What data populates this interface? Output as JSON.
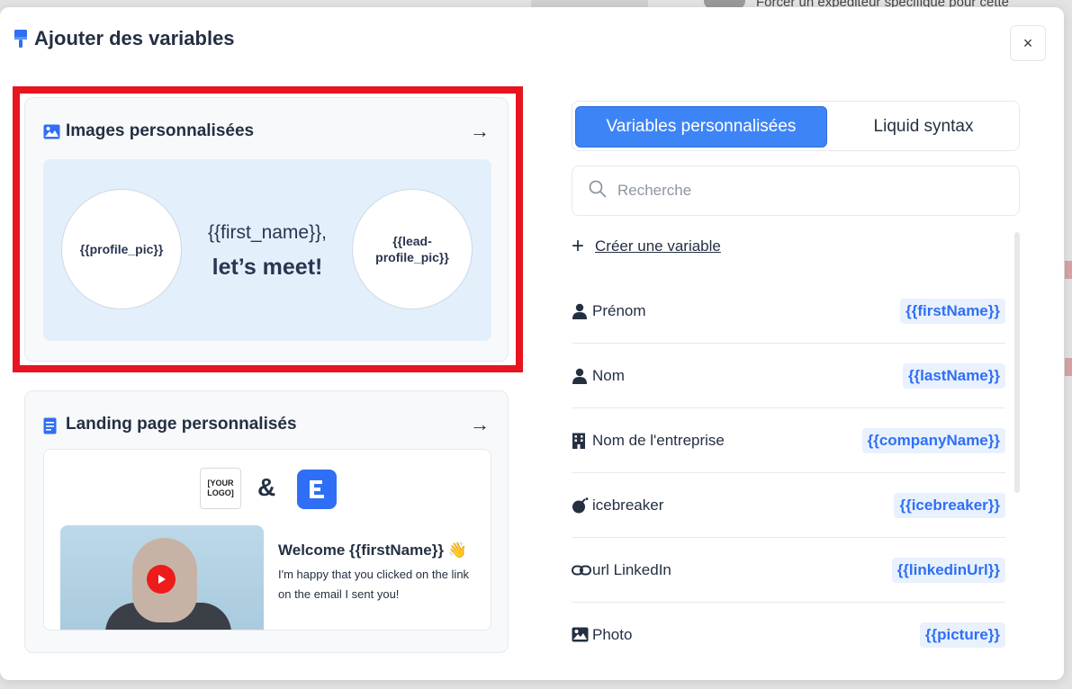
{
  "background": {
    "hint_text": "Forcer un expéditeur spécifique pour cette"
  },
  "modal": {
    "title": "Ajouter des variables",
    "close_label": "×"
  },
  "cards": {
    "images": {
      "label": "Images personnalisées",
      "arrow": "→",
      "preview": {
        "left_circle": "{{profile_pic}}",
        "greeting_line1": "{{first_name}},",
        "greeting_line2": "let’s meet!",
        "right_circle": "{{lead-profile_pic}}"
      }
    },
    "landing": {
      "label": "Landing page personnalisés",
      "arrow": "→",
      "preview": {
        "logo_text": "[YOUR LOGO]",
        "amp": "&",
        "welcome_title": "Welcome {{firstName}} 👋",
        "welcome_text": "I'm happy that you clicked on the link on the email I sent you!"
      }
    }
  },
  "tabs": [
    {
      "label": "Variables personnalisées",
      "active": true
    },
    {
      "label": "Liquid syntax",
      "active": false
    }
  ],
  "search": {
    "placeholder": "Recherche",
    "value": ""
  },
  "create_variable": {
    "label": "Créer une variable"
  },
  "variables": [
    {
      "icon": "person-icon",
      "label": "Prénom",
      "tag": "{{firstName}}"
    },
    {
      "icon": "person-icon",
      "label": "Nom",
      "tag": "{{lastName}}"
    },
    {
      "icon": "building-icon",
      "label": "Nom de l'entreprise",
      "tag": "{{companyName}}"
    },
    {
      "icon": "bomb-icon",
      "label": "icebreaker",
      "tag": "{{icebreaker}}"
    },
    {
      "icon": "link-icon",
      "label": "url LinkedIn",
      "tag": "{{linkedinUrl}}"
    },
    {
      "icon": "image-icon",
      "label": "Photo",
      "tag": "{{picture}}"
    }
  ],
  "colors": {
    "accent": "#3d85f6",
    "tag_text": "#2f6ff5",
    "highlight": "#e8141f"
  }
}
